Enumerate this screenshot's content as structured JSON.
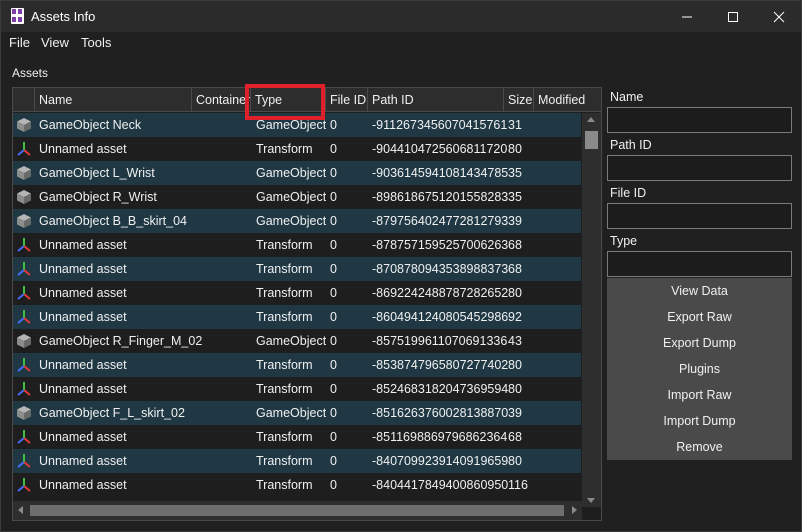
{
  "window": {
    "title": "Assets Info",
    "minimize_glyph": "minimize-icon",
    "maximize_glyph": "maximize-icon",
    "close_glyph": "close-icon"
  },
  "menu": {
    "items": [
      "File",
      "View",
      "Tools"
    ]
  },
  "assets_label": "Assets",
  "columns": [
    "Name",
    "Container",
    "Type",
    "File ID",
    "Path ID",
    "Size",
    "Modified"
  ],
  "rows": [
    {
      "icon": "gameobject-icon",
      "name": "GameObject Neck",
      "container": "",
      "type": "GameObject",
      "file_id": "0",
      "path_id": "-9112673456070415761",
      "size": "31"
    },
    {
      "icon": "transform-icon",
      "name": "Unnamed asset",
      "container": "",
      "type": "Transform",
      "file_id": "0",
      "path_id": "-9044104725606811720",
      "size": "80"
    },
    {
      "icon": "gameobject-icon",
      "name": "GameObject L_Wrist",
      "container": "",
      "type": "GameObject",
      "file_id": "0",
      "path_id": "-9036145941081434785",
      "size": "35"
    },
    {
      "icon": "gameobject-icon",
      "name": "GameObject R_Wrist",
      "container": "",
      "type": "GameObject",
      "file_id": "0",
      "path_id": "-8986186751201558283",
      "size": "35"
    },
    {
      "icon": "gameobject-icon",
      "name": "GameObject B_B_skirt_04",
      "container": "",
      "type": "GameObject",
      "file_id": "0",
      "path_id": "-8797564024772812793",
      "size": "39"
    },
    {
      "icon": "transform-icon",
      "name": "Unnamed asset",
      "container": "",
      "type": "Transform",
      "file_id": "0",
      "path_id": "-8787571595257006263",
      "size": "68"
    },
    {
      "icon": "transform-icon",
      "name": "Unnamed asset",
      "container": "",
      "type": "Transform",
      "file_id": "0",
      "path_id": "-8708780943538988373",
      "size": "68"
    },
    {
      "icon": "transform-icon",
      "name": "Unnamed asset",
      "container": "",
      "type": "Transform",
      "file_id": "0",
      "path_id": "-8692242488787282652",
      "size": "80"
    },
    {
      "icon": "transform-icon",
      "name": "Unnamed asset",
      "container": "",
      "type": "Transform",
      "file_id": "0",
      "path_id": "-8604941240805452986",
      "size": "92"
    },
    {
      "icon": "gameobject-icon",
      "name": "GameObject R_Finger_M_02",
      "container": "",
      "type": "GameObject",
      "file_id": "0",
      "path_id": "-8575199611070691336",
      "size": "43"
    },
    {
      "icon": "transform-icon",
      "name": "Unnamed asset",
      "container": "",
      "type": "Transform",
      "file_id": "0",
      "path_id": "-8538747965807277402",
      "size": "80"
    },
    {
      "icon": "transform-icon",
      "name": "Unnamed asset",
      "container": "",
      "type": "Transform",
      "file_id": "0",
      "path_id": "-8524683182047369594",
      "size": "80"
    },
    {
      "icon": "gameobject-icon",
      "name": "GameObject F_L_skirt_02",
      "container": "",
      "type": "GameObject",
      "file_id": "0",
      "path_id": "-8516263760028138870",
      "size": "39"
    },
    {
      "icon": "transform-icon",
      "name": "Unnamed asset",
      "container": "",
      "type": "Transform",
      "file_id": "0",
      "path_id": "-8511698869796862364",
      "size": "68"
    },
    {
      "icon": "transform-icon",
      "name": "Unnamed asset",
      "container": "",
      "type": "Transform",
      "file_id": "0",
      "path_id": "-8407099239140919659",
      "size": "80"
    },
    {
      "icon": "transform-icon",
      "name": "Unnamed asset",
      "container": "",
      "type": "Transform",
      "file_id": "0",
      "path_id": "-8404417849400860950",
      "size": "116"
    }
  ],
  "fields": {
    "name": {
      "label": "Name",
      "value": ""
    },
    "path_id": {
      "label": "Path ID",
      "value": ""
    },
    "file_id": {
      "label": "File ID",
      "value": ""
    },
    "type": {
      "label": "Type",
      "value": ""
    }
  },
  "actions": [
    "View Data",
    "Export Raw",
    "Export Dump",
    "Plugins",
    "Import Raw",
    "Import Dump",
    "Remove"
  ],
  "colors": {
    "row_alt": "#1f3844",
    "row_plain": "#1e1e1e",
    "highlight": "#e0202a",
    "action_panel": "#4a4a4a"
  }
}
